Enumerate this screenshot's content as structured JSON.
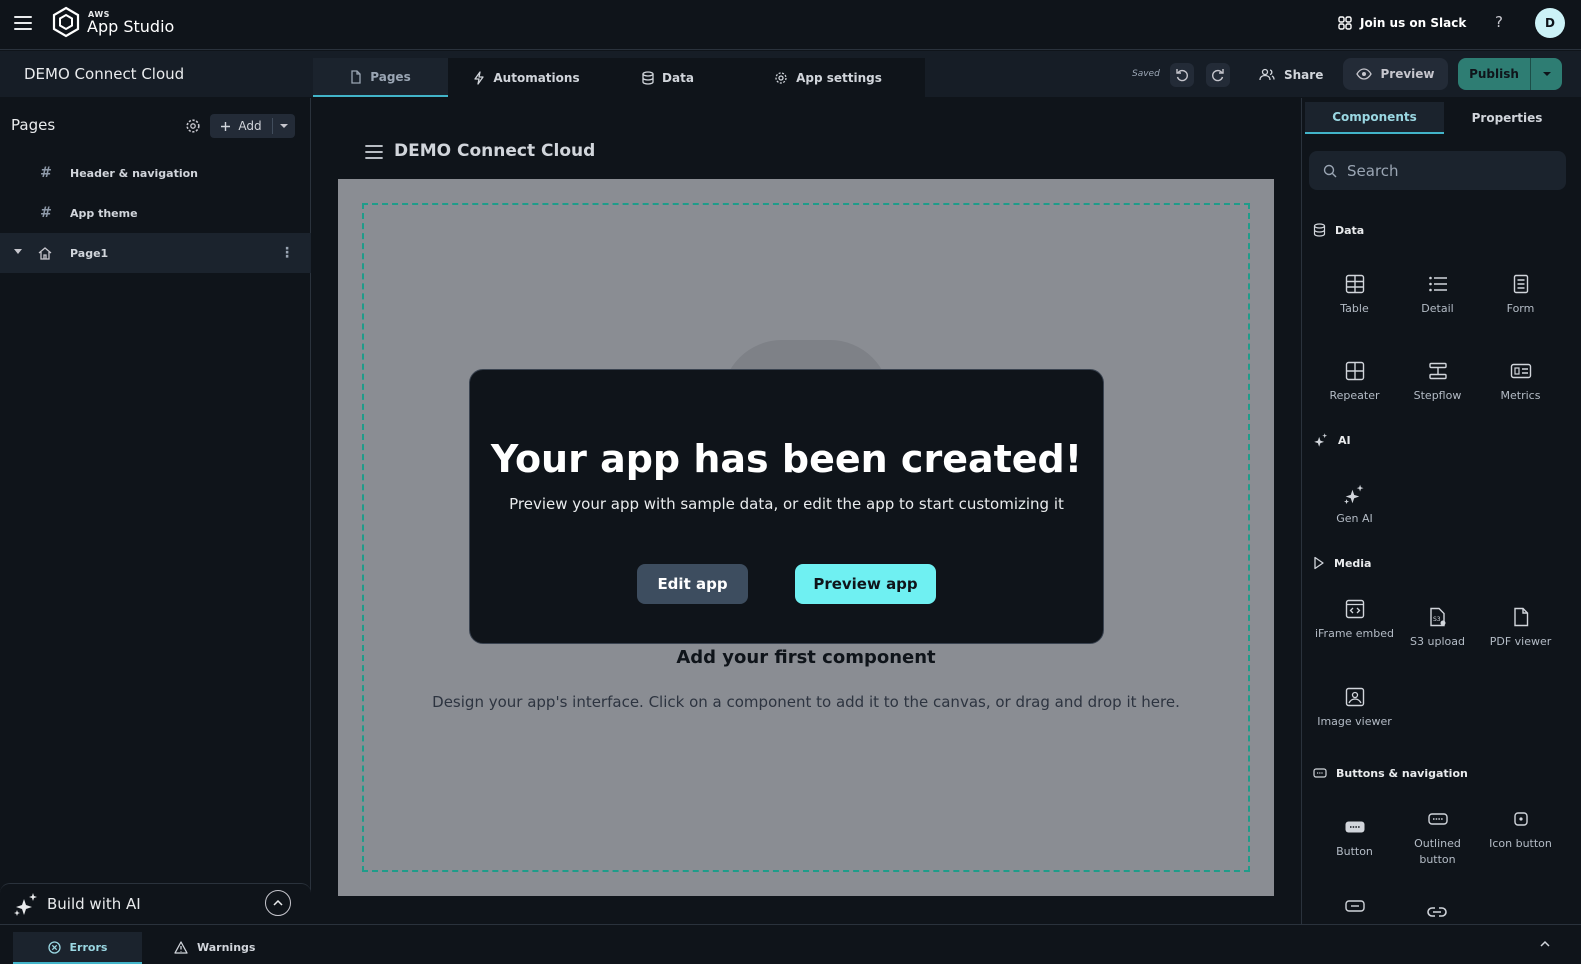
{
  "topbar": {
    "brand_small": "AWS",
    "brand_main": "App Studio",
    "slack_label": "Join us on Slack",
    "help_label": "?",
    "avatar_initial": "D"
  },
  "subbar": {
    "app_name": "DEMO Connect Cloud",
    "tabs": [
      {
        "label": "Pages",
        "icon": "page-icon"
      },
      {
        "label": "Automations",
        "icon": "lightning-icon"
      },
      {
        "label": "Data",
        "icon": "database-icon"
      },
      {
        "label": "App settings",
        "icon": "gear-icon"
      }
    ],
    "saved_label": "Saved",
    "share_label": "Share",
    "preview_label": "Preview",
    "publish_label": "Publish"
  },
  "left_panel": {
    "title": "Pages",
    "add_label": "Add",
    "rows": [
      {
        "label": "Header & navigation",
        "icon": "hash-icon"
      },
      {
        "label": "App theme",
        "icon": "hash-icon"
      },
      {
        "label": "Page1",
        "icon": "home-icon"
      }
    ],
    "build_ai_label": "Build with AI"
  },
  "canvas": {
    "app_name": "DEMO Connect Cloud",
    "add_first_title": "Add your first component",
    "hint": "Design your app's interface. Click on a component to add it to the canvas, or drag and drop it here."
  },
  "modal": {
    "title": "Your app has been created!",
    "subtitle": "Preview your app with sample data, or edit the app to start customizing it",
    "edit_label": "Edit app",
    "preview_label": "Preview app"
  },
  "right_panel": {
    "tabs": [
      "Components",
      "Properties"
    ],
    "search_placeholder": "Search",
    "sections": {
      "data": "Data",
      "ai": "AI",
      "media": "Media",
      "buttons": "Buttons & navigation"
    },
    "components": {
      "table": "Table",
      "detail": "Detail",
      "form": "Form",
      "repeater": "Repeater",
      "stepflow": "Stepflow",
      "metrics": "Metrics",
      "gen_ai": "Gen AI",
      "iframe_embed": "iFrame embed",
      "s3_upload": "S3 upload",
      "pdf_viewer": "PDF viewer",
      "image_viewer": "Image viewer",
      "button": "Button",
      "outlined_button": "Outlined button",
      "icon_button": "Icon button"
    }
  },
  "bottom": {
    "errors_label": "Errors",
    "warnings_label": "Warnings"
  },
  "colors": {
    "accent": "#42b4c9",
    "publish": "#2e7d73",
    "preview_app": "#6ff0f2",
    "dropzone_border": "#1f9c8a"
  }
}
